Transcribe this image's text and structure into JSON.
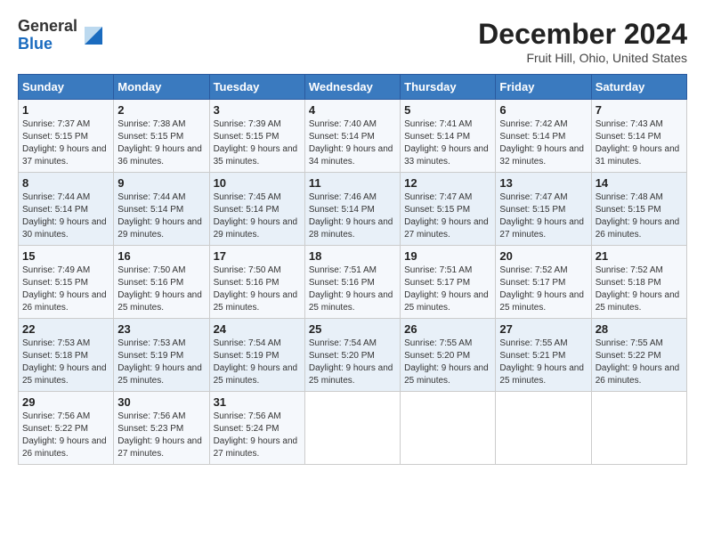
{
  "header": {
    "logo_general": "General",
    "logo_blue": "Blue",
    "title": "December 2024",
    "subtitle": "Fruit Hill, Ohio, United States"
  },
  "calendar": {
    "days_of_week": [
      "Sunday",
      "Monday",
      "Tuesday",
      "Wednesday",
      "Thursday",
      "Friday",
      "Saturday"
    ],
    "weeks": [
      [
        null,
        null,
        null,
        null,
        null,
        null,
        null
      ]
    ]
  },
  "days": {
    "1": {
      "num": "1",
      "sunrise": "7:37 AM",
      "sunset": "5:15 PM",
      "daylight": "9 hours and 37 minutes."
    },
    "2": {
      "num": "2",
      "sunrise": "7:38 AM",
      "sunset": "5:15 PM",
      "daylight": "9 hours and 36 minutes."
    },
    "3": {
      "num": "3",
      "sunrise": "7:39 AM",
      "sunset": "5:15 PM",
      "daylight": "9 hours and 35 minutes."
    },
    "4": {
      "num": "4",
      "sunrise": "7:40 AM",
      "sunset": "5:14 PM",
      "daylight": "9 hours and 34 minutes."
    },
    "5": {
      "num": "5",
      "sunrise": "7:41 AM",
      "sunset": "5:14 PM",
      "daylight": "9 hours and 33 minutes."
    },
    "6": {
      "num": "6",
      "sunrise": "7:42 AM",
      "sunset": "5:14 PM",
      "daylight": "9 hours and 32 minutes."
    },
    "7": {
      "num": "7",
      "sunrise": "7:43 AM",
      "sunset": "5:14 PM",
      "daylight": "9 hours and 31 minutes."
    },
    "8": {
      "num": "8",
      "sunrise": "7:44 AM",
      "sunset": "5:14 PM",
      "daylight": "9 hours and 30 minutes."
    },
    "9": {
      "num": "9",
      "sunrise": "7:44 AM",
      "sunset": "5:14 PM",
      "daylight": "9 hours and 29 minutes."
    },
    "10": {
      "num": "10",
      "sunrise": "7:45 AM",
      "sunset": "5:14 PM",
      "daylight": "9 hours and 29 minutes."
    },
    "11": {
      "num": "11",
      "sunrise": "7:46 AM",
      "sunset": "5:14 PM",
      "daylight": "9 hours and 28 minutes."
    },
    "12": {
      "num": "12",
      "sunrise": "7:47 AM",
      "sunset": "5:15 PM",
      "daylight": "9 hours and 27 minutes."
    },
    "13": {
      "num": "13",
      "sunrise": "7:47 AM",
      "sunset": "5:15 PM",
      "daylight": "9 hours and 27 minutes."
    },
    "14": {
      "num": "14",
      "sunrise": "7:48 AM",
      "sunset": "5:15 PM",
      "daylight": "9 hours and 26 minutes."
    },
    "15": {
      "num": "15",
      "sunrise": "7:49 AM",
      "sunset": "5:15 PM",
      "daylight": "9 hours and 26 minutes."
    },
    "16": {
      "num": "16",
      "sunrise": "7:50 AM",
      "sunset": "5:16 PM",
      "daylight": "9 hours and 25 minutes."
    },
    "17": {
      "num": "17",
      "sunrise": "7:50 AM",
      "sunset": "5:16 PM",
      "daylight": "9 hours and 25 minutes."
    },
    "18": {
      "num": "18",
      "sunrise": "7:51 AM",
      "sunset": "5:16 PM",
      "daylight": "9 hours and 25 minutes."
    },
    "19": {
      "num": "19",
      "sunrise": "7:51 AM",
      "sunset": "5:17 PM",
      "daylight": "9 hours and 25 minutes."
    },
    "20": {
      "num": "20",
      "sunrise": "7:52 AM",
      "sunset": "5:17 PM",
      "daylight": "9 hours and 25 minutes."
    },
    "21": {
      "num": "21",
      "sunrise": "7:52 AM",
      "sunset": "5:18 PM",
      "daylight": "9 hours and 25 minutes."
    },
    "22": {
      "num": "22",
      "sunrise": "7:53 AM",
      "sunset": "5:18 PM",
      "daylight": "9 hours and 25 minutes."
    },
    "23": {
      "num": "23",
      "sunrise": "7:53 AM",
      "sunset": "5:19 PM",
      "daylight": "9 hours and 25 minutes."
    },
    "24": {
      "num": "24",
      "sunrise": "7:54 AM",
      "sunset": "5:19 PM",
      "daylight": "9 hours and 25 minutes."
    },
    "25": {
      "num": "25",
      "sunrise": "7:54 AM",
      "sunset": "5:20 PM",
      "daylight": "9 hours and 25 minutes."
    },
    "26": {
      "num": "26",
      "sunrise": "7:55 AM",
      "sunset": "5:20 PM",
      "daylight": "9 hours and 25 minutes."
    },
    "27": {
      "num": "27",
      "sunrise": "7:55 AM",
      "sunset": "5:21 PM",
      "daylight": "9 hours and 25 minutes."
    },
    "28": {
      "num": "28",
      "sunrise": "7:55 AM",
      "sunset": "5:22 PM",
      "daylight": "9 hours and 26 minutes."
    },
    "29": {
      "num": "29",
      "sunrise": "7:56 AM",
      "sunset": "5:22 PM",
      "daylight": "9 hours and 26 minutes."
    },
    "30": {
      "num": "30",
      "sunrise": "7:56 AM",
      "sunset": "5:23 PM",
      "daylight": "9 hours and 27 minutes."
    },
    "31": {
      "num": "31",
      "sunrise": "7:56 AM",
      "sunset": "5:24 PM",
      "daylight": "9 hours and 27 minutes."
    }
  },
  "labels": {
    "sunrise": "Sunrise:",
    "sunset": "Sunset:",
    "daylight": "Daylight:"
  }
}
